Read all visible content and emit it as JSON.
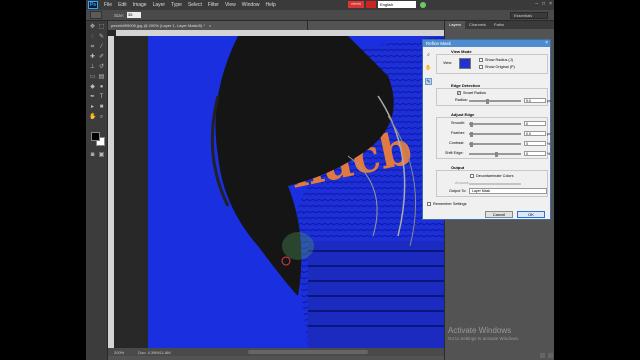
{
  "menu": {
    "logo": "Ps",
    "items": [
      "File",
      "Edit",
      "Image",
      "Layer",
      "Type",
      "Select",
      "Filter",
      "View",
      "Window",
      "Help"
    ]
  },
  "language": {
    "badge": "বাংলায়",
    "selected": "English"
  },
  "options_bar": {
    "size_label": "Size:",
    "size_value": "35",
    "workspace": "Essentials"
  },
  "document": {
    "tab_title": "pexels999009.jpg @ 200% (Layer 1, Layer Mask/8) *",
    "close": "×"
  },
  "status": {
    "zoom": "200%",
    "doc_info": "Doc: 4.39M/11.8M"
  },
  "panels": {
    "tabs": [
      "Layers",
      "Channels",
      "Paths"
    ]
  },
  "dialog": {
    "title": "Refine Mask",
    "view_mode": {
      "label": "View Mode",
      "view_label": "View:",
      "show_radius": "Show Radius (J)",
      "show_original": "Show Original (P)"
    },
    "edge_detection": {
      "label": "Edge Detection",
      "smart_radius": "Smart Radius",
      "radius_label": "Radius:",
      "radius_value": "9.0",
      "radius_unit": "px",
      "radius_fraction": 0.35
    },
    "adjust_edge": {
      "label": "Adjust Edge",
      "smooth_label": "Smooth:",
      "smooth_value": "0",
      "feather_label": "Feather:",
      "feather_value": "0.0",
      "feather_unit": "px",
      "contrast_label": "Contrast:",
      "contrast_value": "0",
      "contrast_unit": "%",
      "shift_label": "Shift Edge:",
      "shift_value": "0",
      "shift_unit": "%"
    },
    "output": {
      "label": "Output",
      "decontaminate": "Decontaminate Colors",
      "amount_label": "Amount:",
      "output_to_label": "Output To:",
      "output_to_value": "Layer Mask"
    },
    "remember": "Remember Settings",
    "cancel": "Cancel",
    "ok": "OK"
  },
  "watermark": {
    "title": "Activate Windows",
    "subtitle": "Go to Settings to activate Windows."
  },
  "colors": {
    "canvas_blue": "#1a2fe0",
    "dialog_title": "#4f8ccf",
    "logo_blue": "#31a8ff"
  }
}
